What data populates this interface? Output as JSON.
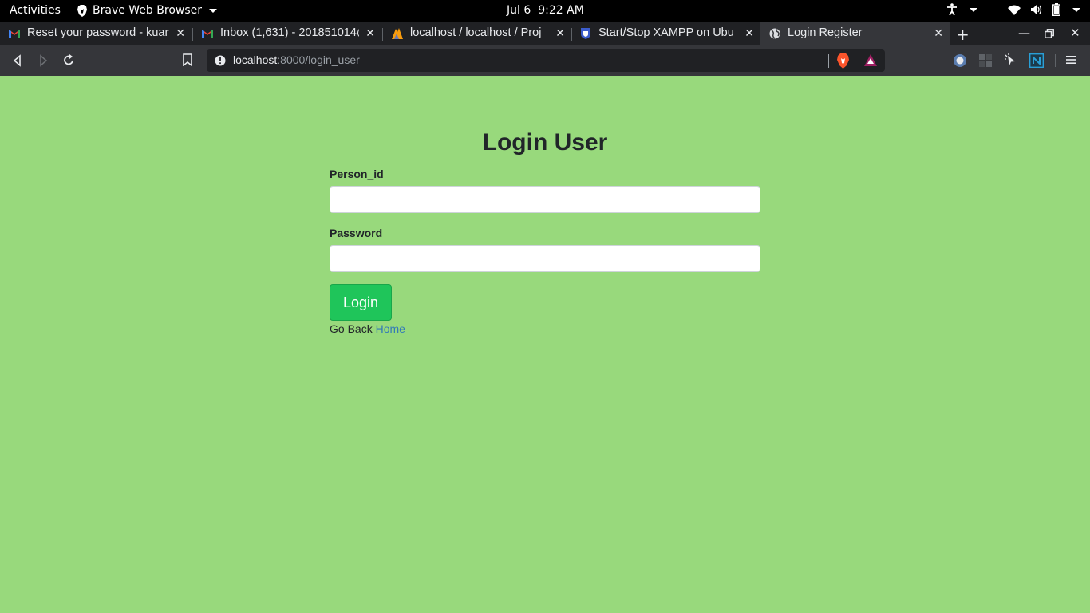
{
  "system_bar": {
    "activities": "Activities",
    "app_name": "Brave Web Browser",
    "date": "Jul 6",
    "time": "9:22 AM",
    "icons": [
      "accessibility-icon",
      "wifi-icon",
      "volume-icon",
      "battery-icon",
      "power-menu-icon"
    ]
  },
  "browser": {
    "tabs": [
      {
        "title": "Reset your password - kuan",
        "favicon": "gmail-icon",
        "active": false
      },
      {
        "title": "Inbox (1,631) - 201851014@",
        "favicon": "gmail-icon",
        "active": false
      },
      {
        "title": "localhost / localhost / Proj",
        "favicon": "phpmyadmin-icon",
        "active": false
      },
      {
        "title": "Start/Stop XAMPP on Ubu",
        "favicon": "xampp-shield-icon",
        "active": false
      },
      {
        "title": "Login Register",
        "favicon": "globe-icon",
        "active": true
      }
    ],
    "url_host": "localhost",
    "url_rest": ":8000/login_user",
    "extensions": [
      "extension-circle-icon",
      "extension-grid-icon",
      "extension-cursor-icon",
      "extension-n-icon"
    ]
  },
  "page": {
    "title": "Login User",
    "person_id_label": "Person_id",
    "person_id_value": "",
    "password_label": "Password",
    "password_value": "",
    "login_button": "Login",
    "go_back_text": "Go Back",
    "home_link": "Home"
  },
  "colors": {
    "page_background": "#98d97c",
    "login_button": "#1fc55a",
    "link": "#337ab7"
  }
}
